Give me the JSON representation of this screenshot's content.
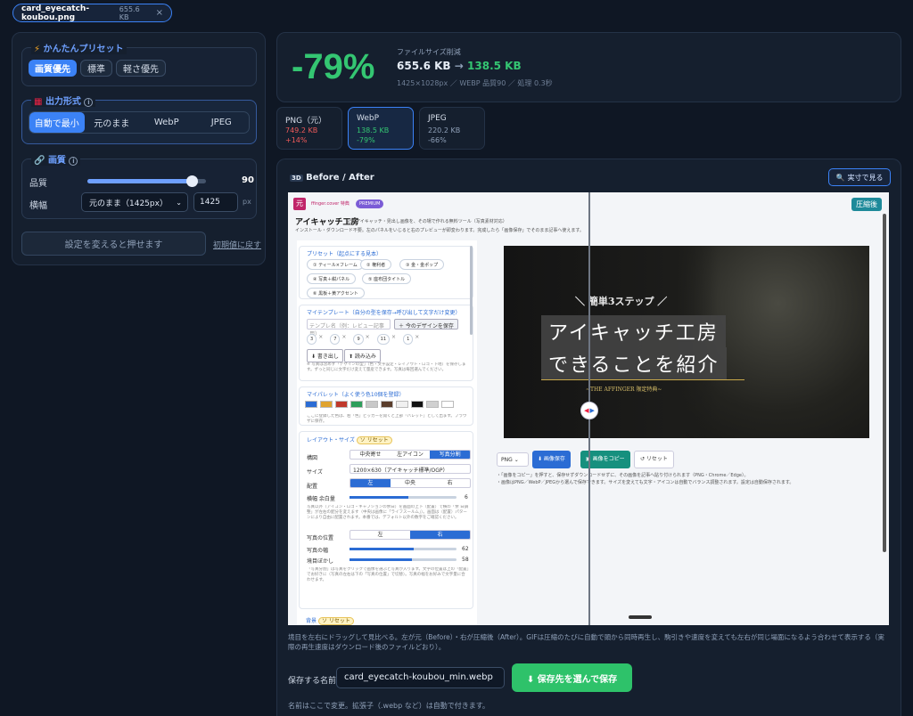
{
  "file_tab": {
    "name": "card_eyecatch-koubou.png",
    "size": "655.6 KB",
    "close": "×"
  },
  "preset": {
    "title": "かんたんプリセット",
    "options": [
      "画質優先",
      "標準",
      "軽さ優先"
    ],
    "active": 0
  },
  "format": {
    "title": "出力形式",
    "info": "i",
    "options": [
      "自動で最小",
      "元のまま",
      "WebP",
      "JPEG"
    ],
    "active": 0
  },
  "quality": {
    "title": "画質",
    "info": "i",
    "q_label": "品質",
    "q_value": "90",
    "q_fraction": 0.88,
    "w_label": "横幅",
    "w_select": "元のまま（1425px）",
    "w_value": "1425",
    "w_unit": "px"
  },
  "apply": {
    "label": "設定を変えると押せます",
    "reset": "初期値に戻す"
  },
  "summary": {
    "percent": "-79%",
    "caption": "ファイルサイズ削減",
    "before": "655.6 KB",
    "arrow": "→",
    "after": "138.5 KB",
    "meta": "1425×1028px ／ WEBP 品質90 ／ 処理 0.3秒"
  },
  "cards": [
    {
      "name": "PNG（元）",
      "size": "749.2 KB",
      "diff": "+14%"
    },
    {
      "name": "WebP",
      "size": "138.5 KB",
      "diff": "-79%"
    },
    {
      "name": "JPEG",
      "size": "220.2 KB",
      "diff": "-66%"
    }
  ],
  "compare": {
    "icon": "3D",
    "title": "Before / After",
    "real_btn": "実寸で見る",
    "badge_after": "圧縮後"
  },
  "app": {
    "badge": "元",
    "brand": "ffinger.cover 特典",
    "premium": "PREMIUM",
    "title": "アイキャッチ工房",
    "desc1": "記事アイキャッチ・見出し画像を、その場で作れる無料ツール（写真素材対応）",
    "desc2": "インストール・ダウンロード不要。左のパネルをいじると右のプレビューが即変わります。完成したら「画像保存」でそのまま記事へ使えます。",
    "preset_head": "プリセット（起点にする見本）",
    "preset_chips": [
      "① ティール×フレーム",
      "② 権利者",
      "③ 金・金ポップ",
      "④ 写真＋紺パネル",
      "⑤ 座布団タイトル",
      "⑥ 黒板＋黄アクセント"
    ],
    "tpl_head": "マイテンプレート（自分の型を保存→呼び出して文字だけ変更）",
    "tpl_placeholder": "テンプレ名（例：レビュー記事用）",
    "tpl_save": "＋ 今のデザインを保存",
    "tpl_nums": [
      "3",
      "7",
      "9",
      "11",
      "1"
    ],
    "tpl_x": "×",
    "tpl_export": "⬇ 書き出し",
    "tpl_import": "⬆ 読み込み",
    "tpl_note": "※ 写真は含めず「デザインの型」（色・文字設定・レイアウト・ロゴ・下地）を保存します。ずっと同じに文字だけ変えて量産できます。写真は毎回選んでください。",
    "palette_head": "マイパレット（よく使う色10個を登録）",
    "palette": [
      "#2b6cd4",
      "#e0a32e",
      "#c0392b",
      "#2e9e5b",
      "#c8c8c8",
      "#5a3d2b",
      "#f0f0f0",
      "#111111",
      "#d0d0d0",
      "#ffffff"
    ],
    "palette_note": "ここに登録した色は、右「色」ピッカーを開くと上部「パレット」として出ます。ブラウザに保存。",
    "layout_head": "レイアウト・サイズ",
    "layout_tag": "ソ リセット",
    "form_label": "構図",
    "form_opts": [
      "中央寄せ",
      "左アイコン",
      "写真分割"
    ],
    "size_label": "サイズ",
    "size_value": "1200×630（アイキャッチ標準/OGP）",
    "pos_label": "配置",
    "pos_opts": [
      "左",
      "中央",
      "右"
    ],
    "ratio_label": "横幅 余白量",
    "ratio_value": "6",
    "ratio_note": "写真以外（アイコン・ロゴ・キャプションの余白）を画面の上下（配置）で横の「余 白調整」が左右の配分を変えます（中央は画像に「ライフスールム」）。画面は（配置）パター ンにより自由に配置されます。本番では、デフォルト以外の数字をご確認ください。",
    "photo_pos_label": "写真の位置",
    "photo_pos_opts": [
      "左",
      "右"
    ],
    "photo_w_label": "写真の幅",
    "photo_w_value": "62",
    "border_label": "境目ぼかし",
    "border_value": "58",
    "photo_note": "「写真分割」は写真をクリックで画像を選ぶと写真が入ります。文字の位置は上の「配置」でお好きに（写真の左右は下の「写真の位置」で切替）。写真の幅をお好みで文字量に合わせます。",
    "bg_head": "背景",
    "bg_tag": "ソ リセット",
    "card_line1": "＼ 簡単3ステップ ／",
    "card_title1": "アイキャッチ工房",
    "card_title2": "できることを紹介",
    "card_sub": "~THE AFFINGER 限定特典~",
    "fmt_select": "PNG",
    "save_btn": "⬇ 画像保存",
    "copy_btn": "▣ 画像をコピー",
    "reset_btn": "↺ リセット",
    "save_note1": "・「画像をコピー」を押すと、保存せずダウンロードせずに、その画像を記事へ貼り付けられます（PNG・Chrome／Edge）。",
    "save_note2": "・画像はPNG／WebP／JPEGから選んで保存できます。サイズを変えても文字・アイコンは自動でバランス調整されます。設定は自動保存されます。"
  },
  "hint": "境目を左右にドラッグして見比べる。左が元（Before）・右が圧縮後（After）。GIFは圧縮のたびに自動で頭から同時再生し、駒引きや速度を変えても左右が同じ場面になるよう合わせて表示する（実際の再生速度はダウンロード後のファイルどおり）。",
  "save": {
    "label": "保存する名前",
    "filename": "card_eyecatch-koubou_min.webp",
    "button": "⬇ 保存先を選んで保存",
    "note": "名前はここで変更。拡張子（.webp など）は自動で付きます。"
  }
}
